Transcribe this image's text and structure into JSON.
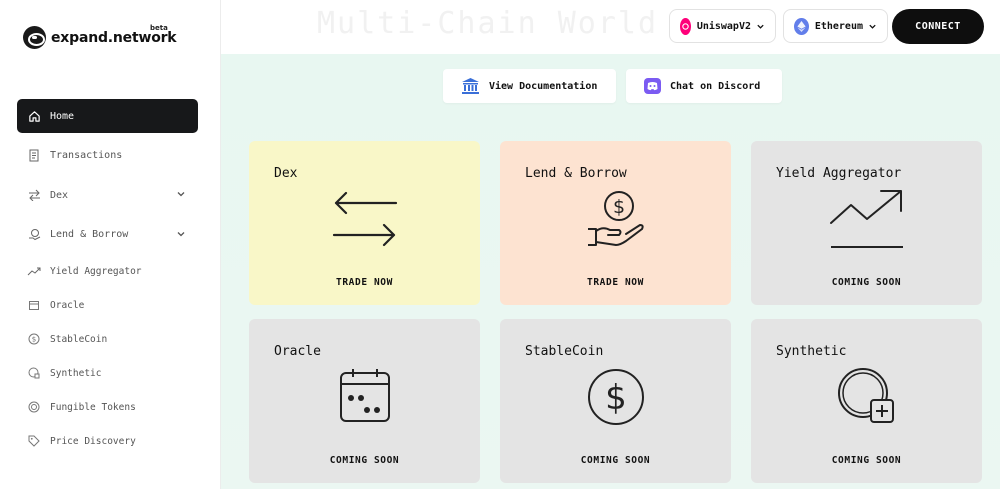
{
  "app": {
    "logo_text": "expand.network",
    "logo_badge": "beta"
  },
  "sidebar": {
    "items": [
      {
        "label": "Home",
        "icon": "home-icon",
        "active": true
      },
      {
        "label": "Transactions",
        "icon": "receipt-icon"
      },
      {
        "label": "Dex",
        "icon": "swap-icon",
        "expandable": true
      },
      {
        "label": "Lend & Borrow",
        "icon": "coins-icon",
        "expandable": true
      },
      {
        "label": "Yield Aggregator",
        "icon": "trend-icon"
      },
      {
        "label": "Oracle",
        "icon": "calendar-icon"
      },
      {
        "label": "StableCoin",
        "icon": "dollar-icon"
      },
      {
        "label": "Synthetic",
        "icon": "synthetic-icon"
      },
      {
        "label": "Fungible Tokens",
        "icon": "token-icon"
      },
      {
        "label": "Price Discovery",
        "icon": "tag-icon"
      }
    ]
  },
  "header": {
    "ghost_title": "Multi-Chain World",
    "protocol_select": "UniswapV2",
    "chain_select": "Ethereum",
    "connect_label": "CONNECT"
  },
  "links": {
    "docs_label": "View Documentation",
    "discord_label": "Chat on Discord"
  },
  "cards": [
    {
      "title": "Dex",
      "cta": "TRADE NOW",
      "icon": "swap-arrows-icon"
    },
    {
      "title": "Lend & Borrow",
      "cta": "TRADE NOW",
      "icon": "coin-hand-icon"
    },
    {
      "title": "Yield Aggregator",
      "cta": "COMING SOON",
      "icon": "trend-chart-icon"
    },
    {
      "title": "Oracle",
      "cta": "COMING SOON",
      "icon": "calendar-icon"
    },
    {
      "title": "StableCoin",
      "cta": "COMING SOON",
      "icon": "dollar-circle-icon"
    },
    {
      "title": "Synthetic",
      "cta": "COMING SOON",
      "icon": "synthetic-coin-icon"
    }
  ],
  "colors": {
    "accent_dark": "#17181a",
    "card_yellow": "#f9f7c8",
    "card_peach": "#fde3d1",
    "card_gray": "#e4e4e4",
    "uniswap_pink": "#ff007a",
    "ethereum_purple": "#627eea",
    "discord_purple": "#7b5bf2",
    "docs_blue": "#3a6fd8"
  }
}
